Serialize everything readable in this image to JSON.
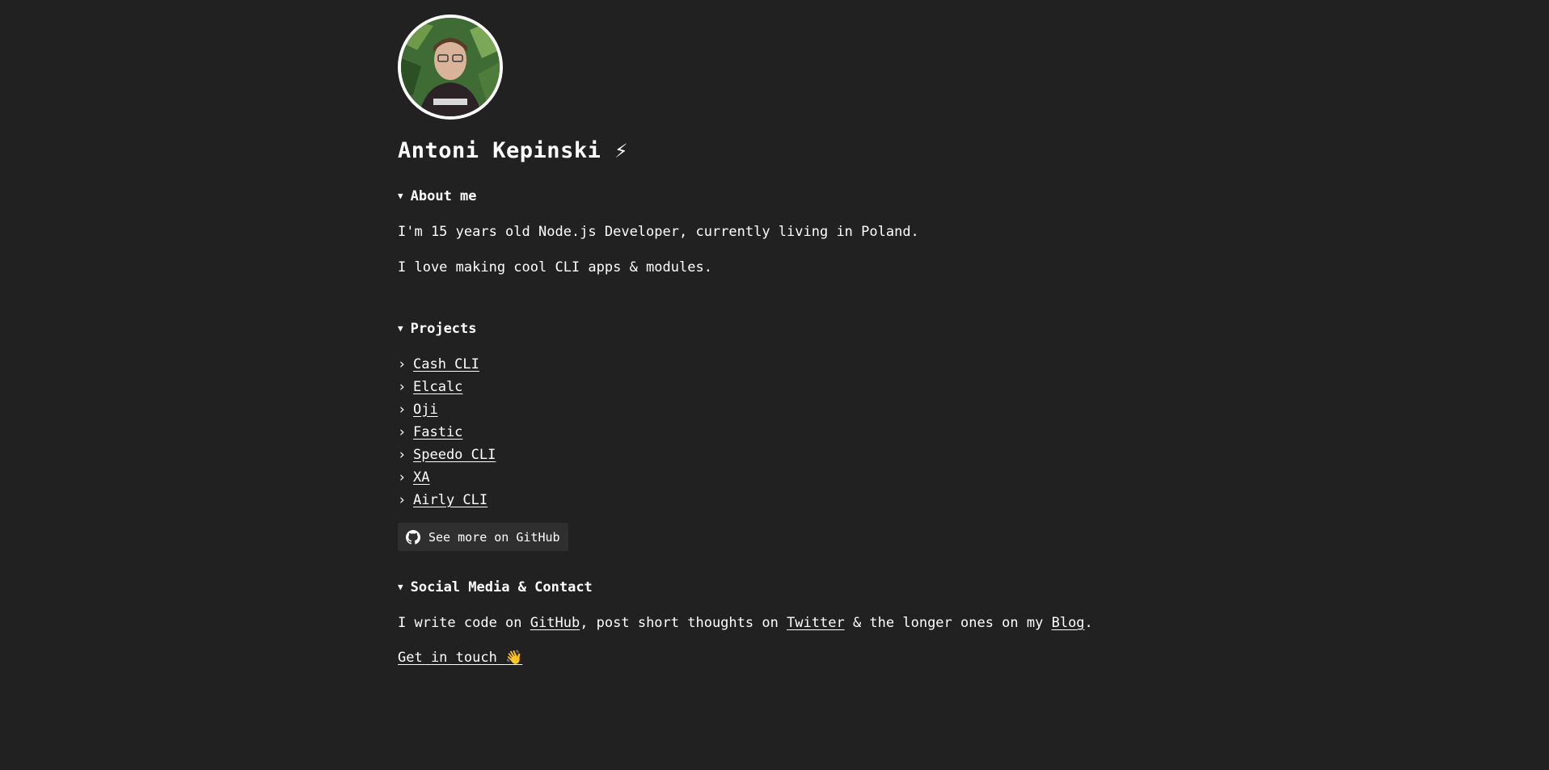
{
  "profile": {
    "name": "Antoni Kepinski ⚡",
    "avatar_alt": "Profile photo"
  },
  "about": {
    "title": "About me",
    "p1": "I'm 15 years old Node.js Developer, currently living in Poland.",
    "p2": "I love making cool CLI apps & modules."
  },
  "projects": {
    "title": "Projects",
    "items": [
      {
        "label": "Cash CLI"
      },
      {
        "label": "Elcalc"
      },
      {
        "label": "Oji"
      },
      {
        "label": "Fastic"
      },
      {
        "label": "Speedo CLI"
      },
      {
        "label": "XA"
      },
      {
        "label": "Airly CLI"
      }
    ],
    "github_button": "See more on GitHub"
  },
  "social": {
    "title": "Social Media & Contact",
    "text_1": "I write code on ",
    "github_link": "GitHub",
    "text_2": ", post short thoughts on ",
    "twitter_link": "Twitter",
    "text_3": " & the longer ones on my ",
    "blog_link": "Blog",
    "text_4": ".",
    "get_in_touch": "Get in touch 👋"
  },
  "ui": {
    "disclosure_open": "▼",
    "list_chevron": "›"
  },
  "colors": {
    "background": "#212121",
    "text": "#ffffff",
    "button_bg": "#2f2f2f"
  }
}
